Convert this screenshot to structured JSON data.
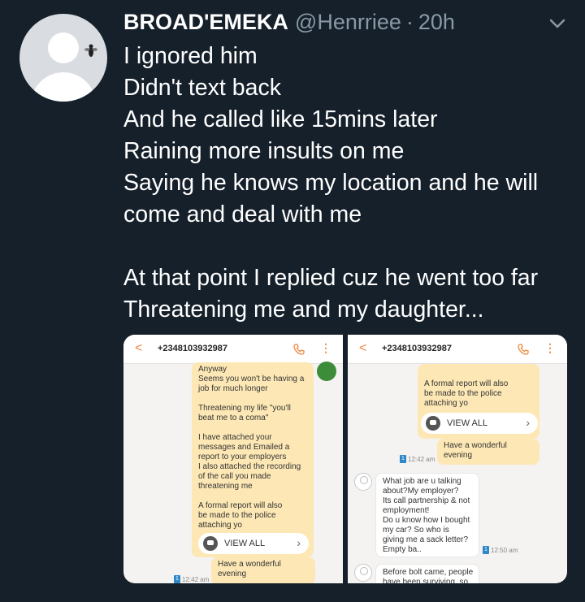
{
  "tweet": {
    "display_name": "BROAD'EMEKA",
    "handle": "@Henrriee",
    "separator": "·",
    "time": "20h",
    "lines": [
      "I ignored him",
      "Didn't text back",
      "And he called like 15mins later",
      "Raining more insults on me",
      "Saying he knows my location and he will",
      "come and deal with me",
      "",
      "At that point I replied cuz he went too far",
      "Threatening me and my daughter..."
    ]
  },
  "icons": {
    "avatar": "avatar-fly-icon",
    "caret": "chevron-down-icon",
    "back": "back-arrow-icon",
    "call": "phone-icon",
    "more": "more-vert-icon"
  },
  "colors": {
    "background": "#15202b",
    "secondary_text": "#8899a6",
    "accent_orange": "#f0883e",
    "sent_bubble": "#fde8b5"
  },
  "screenshot_left": {
    "back": "<",
    "phone_number": "+2348103932987",
    "more": "⋮",
    "sent_message": "Anyway\nSeems you won't be having a\njob for much longer\n\nThreatening my life \"you'll\nbeat me to a coma\"\n\nI have attached your\nmessages and Emailed a\nreport to your employers\nI also attached the recording\nof the call you made\nthreatening me\n\nA formal report will also\nbe made to the police\nattaching yo",
    "view_all": "VIEW ALL",
    "second_message": "Have a wonderful\nevening",
    "sim": "1",
    "time": "12:42 am"
  },
  "screenshot_right": {
    "back": "<",
    "phone_number": "+2348103932987",
    "more": "⋮",
    "sent_message": "A formal report will also\nbe made to the police\nattaching yo",
    "view_all": "VIEW ALL",
    "second_message": "Have a wonderful\nevening",
    "sim": "1",
    "time_sent": "12:42 am",
    "reply_1": "What job are u talking\nabout?My employer?\nIts call partnership & not\nemployment!\nDo u know how I bought\nmy car? So who is\ngiving me a sack letter?\nEmpty ba..",
    "time_reply_1": "12:50 am",
    "reply_2": "Before bolt came, people\nhave been surviving, so"
  }
}
